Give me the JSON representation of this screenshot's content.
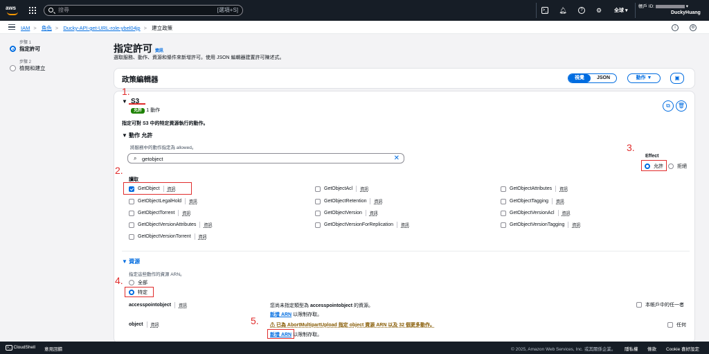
{
  "topnav": {
    "logo": "aws",
    "search_placeholder": "搜尋",
    "search_shortcut": "[選項+S]",
    "region": "全球 ▾",
    "account_prefix": "帳戶 ID:",
    "account_name": "DuckyHuang"
  },
  "breadcrumb": {
    "items": [
      "IAM",
      "角色",
      "Ducky-API-get-URL-role-ybel04jp"
    ],
    "current": "建立政策"
  },
  "steps": [
    {
      "small": "步驟 1",
      "title": "指定許可"
    },
    {
      "small": "步驟 2",
      "title": "檢閱和建立"
    }
  ],
  "page": {
    "title": "指定許可",
    "info": "資訊",
    "description": "選取服務、動作、資源和條件來新增許可。使用 JSON 編輯器建置許可陳述式。"
  },
  "editor": {
    "title": "政策編輯器",
    "view_visual": "視覺",
    "view_json": "JSON",
    "actions_btn": "動作 ▼"
  },
  "service": {
    "name": "S3",
    "badge": "允許",
    "action_count": "1 動作",
    "spec_text": "指定可對 S3 中的特定資源執行的動作。",
    "actions_header": "▼ 動作 允許",
    "actions_sub": "將服務中的動作指定為 allowed。",
    "search_value": "getobject",
    "effect_label": "Effect",
    "effect_allow": "允許",
    "effect_deny": "拒絕",
    "read_label": "讀取"
  },
  "actions": [
    {
      "name": "GetObject",
      "checked": true
    },
    {
      "name": "GetObjectAcl",
      "checked": false
    },
    {
      "name": "GetObjectAttributes",
      "checked": false
    },
    {
      "name": "GetObjectLegalHold",
      "checked": false
    },
    {
      "name": "GetObjectRetention",
      "checked": false
    },
    {
      "name": "GetObjectTagging",
      "checked": false
    },
    {
      "name": "GetObjectTorrent",
      "checked": false
    },
    {
      "name": "GetObjectVersion",
      "checked": false
    },
    {
      "name": "GetObjectVersionAcl",
      "checked": false
    },
    {
      "name": "GetObjectVersionAttributes",
      "checked": false
    },
    {
      "name": "GetObjectVersionForReplication",
      "checked": false
    },
    {
      "name": "GetObjectVersionTagging",
      "checked": false
    },
    {
      "name": "GetObjectVersionTorrent",
      "checked": false
    }
  ],
  "info_label": "資訊",
  "resources": {
    "header": "▼ 資源",
    "sub": "指定這些動作的資源 ARN。",
    "opt_all": "全部",
    "opt_specific": "特定",
    "rows": [
      {
        "type": "accesspointobject",
        "info": "資訊",
        "msg_pre": "您尚未指定類型為 ",
        "msg_bold": "accesspointobject",
        "msg_post": " 的資源。",
        "add_arn": "新增 ARN",
        "add_suffix": " 以限制存取。",
        "any_label": "本帳戶中的任一者"
      },
      {
        "type": "object",
        "info": "資訊",
        "msg_warn": "⚠ 已為 AbortMultipartUpload 指定 object 資源 ARN 以及 32 個更多動作。",
        "add_arn": "新增 ARN",
        "add_suffix": " 以限制存取。",
        "any_label": "任何"
      }
    ]
  },
  "annotations": [
    "1.",
    "2.",
    "3.",
    "4.",
    "5."
  ],
  "footer": {
    "cloudshell": "CloudShell",
    "feedback": "意見回饋",
    "copyright": "© 2025, Amazon Web Services, Inc. 或其關係企業。",
    "privacy": "隱私權",
    "terms": "條款",
    "cookie": "Cookie 喜好設定"
  }
}
